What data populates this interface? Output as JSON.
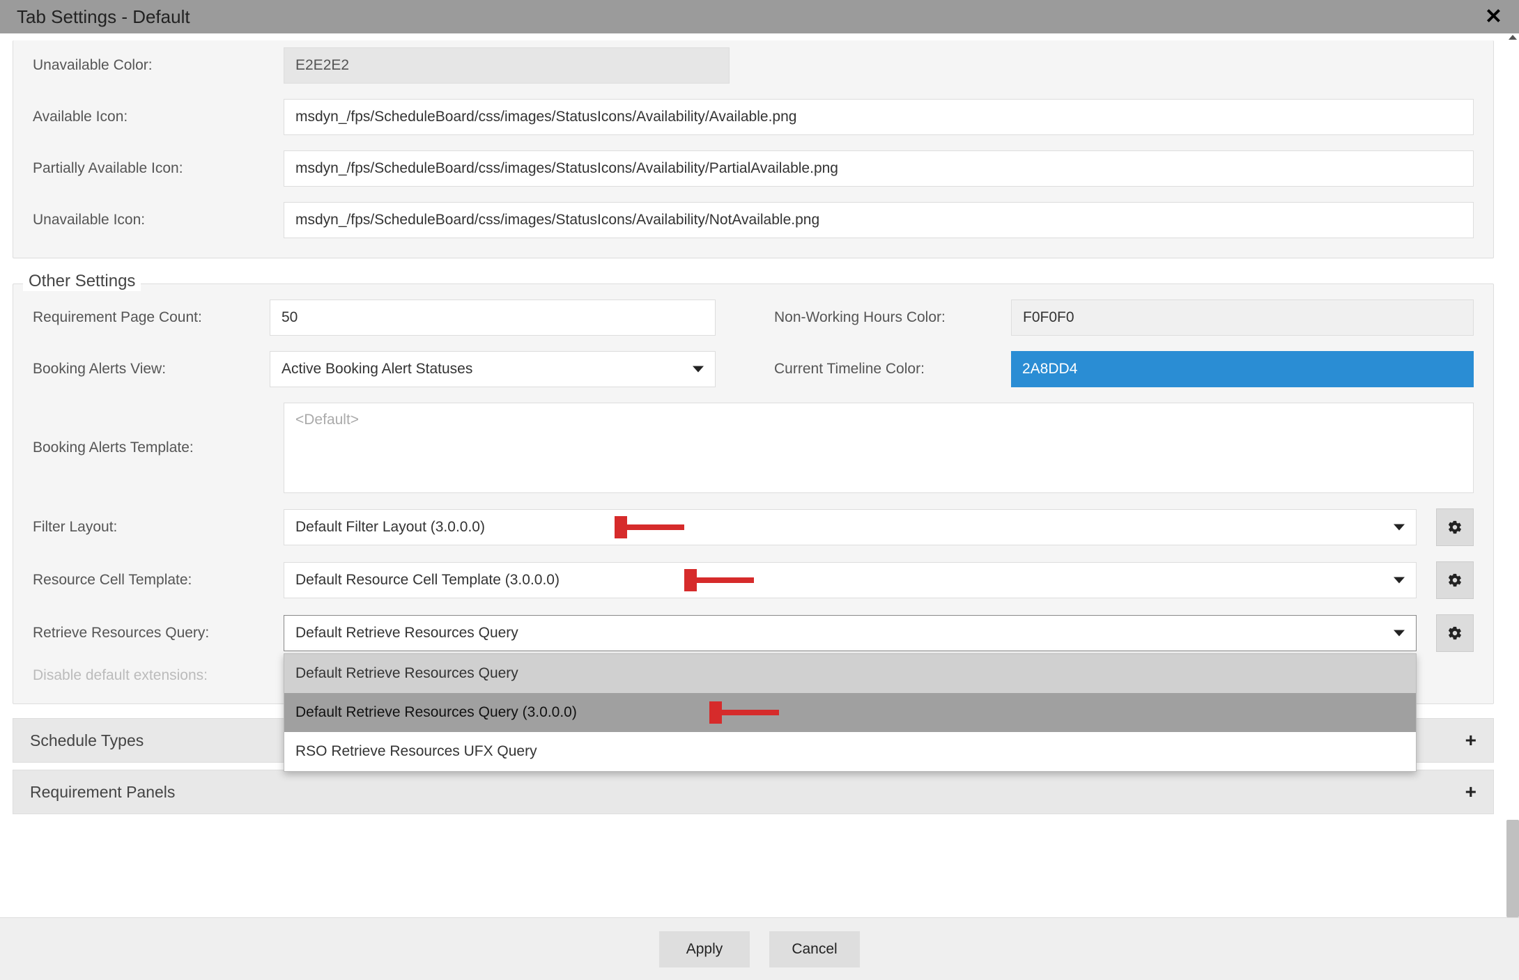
{
  "titlebar": {
    "title": "Tab Settings - Default"
  },
  "availability": {
    "unavailable_color_label": "Unavailable Color:",
    "unavailable_color_value": "E2E2E2",
    "available_icon_label": "Available Icon:",
    "available_icon_value": "msdyn_/fps/ScheduleBoard/css/images/StatusIcons/Availability/Available.png",
    "partial_icon_label": "Partially Available Icon:",
    "partial_icon_value": "msdyn_/fps/ScheduleBoard/css/images/StatusIcons/Availability/PartialAvailable.png",
    "unavailable_icon_label": "Unavailable Icon:",
    "unavailable_icon_value": "msdyn_/fps/ScheduleBoard/css/images/StatusIcons/Availability/NotAvailable.png"
  },
  "other": {
    "legend": "Other Settings",
    "req_page_count_label": "Requirement Page Count:",
    "req_page_count_value": "50",
    "nonworking_color_label": "Non-Working Hours Color:",
    "nonworking_color_value": "F0F0F0",
    "alerts_view_label": "Booking Alerts View:",
    "alerts_view_value": "Active Booking Alert Statuses",
    "timeline_color_label": "Current Timeline Color:",
    "timeline_color_value": "2A8DD4",
    "alerts_template_label": "Booking Alerts Template:",
    "alerts_template_placeholder": "<Default>",
    "filter_layout_label": "Filter Layout:",
    "filter_layout_value": "Default Filter Layout (3.0.0.0)",
    "resource_cell_label": "Resource Cell Template:",
    "resource_cell_value": "Default Resource Cell Template (3.0.0.0)",
    "retrieve_query_label": "Retrieve Resources Query:",
    "retrieve_query_value": "Default Retrieve Resources Query",
    "retrieve_query_options": {
      "0": "Default Retrieve Resources Query",
      "1": "Default Retrieve Resources Query (3.0.0.0)",
      "2": "RSO Retrieve Resources UFX Query"
    },
    "disable_ext_label": "Disable default extensions:"
  },
  "accordion": {
    "schedule_types": "Schedule Types",
    "requirement_panels": "Requirement Panels"
  },
  "footer": {
    "apply": "Apply",
    "cancel": "Cancel"
  }
}
